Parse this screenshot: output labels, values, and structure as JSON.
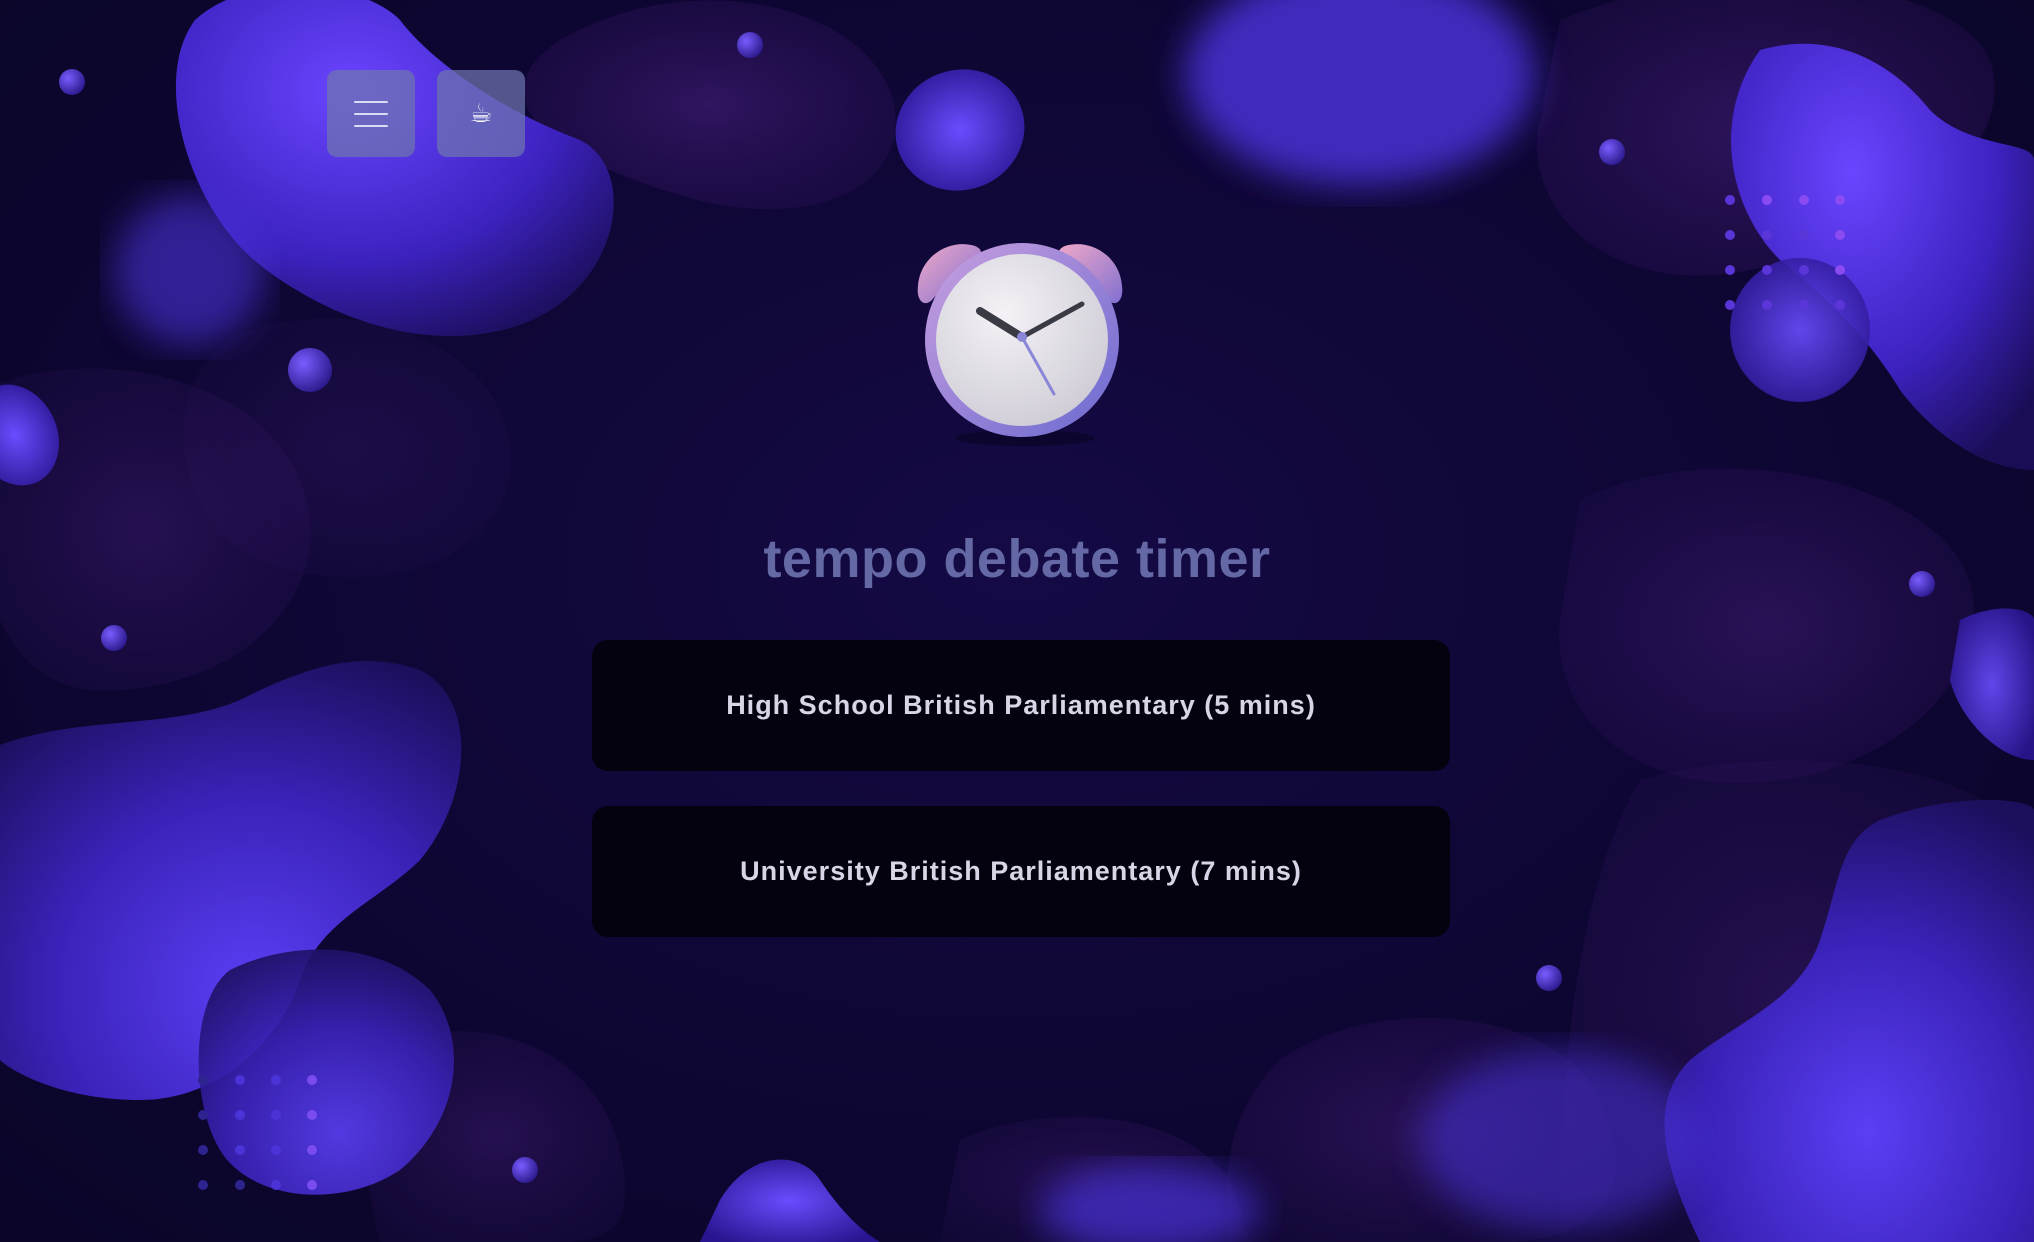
{
  "app": {
    "title": "tempo debate timer"
  },
  "toolbar": {
    "menu_icon": "hamburger-menu-icon",
    "coffee_icon": "coffee-cup-icon",
    "coffee_glyph": "☕"
  },
  "hero": {
    "icon": "alarm-clock-icon"
  },
  "formats": [
    {
      "label": "High School British Parliamentary (5 mins)"
    },
    {
      "label": "University British Parliamentary (7 mins)"
    }
  ],
  "colors": {
    "background": "#0e0630",
    "accent_blob": "#5a3ef0",
    "title_text": "#6469a5",
    "button_bg": "#03020c",
    "button_text": "#d6d6e6",
    "toolbar_button": "#6e76af"
  }
}
